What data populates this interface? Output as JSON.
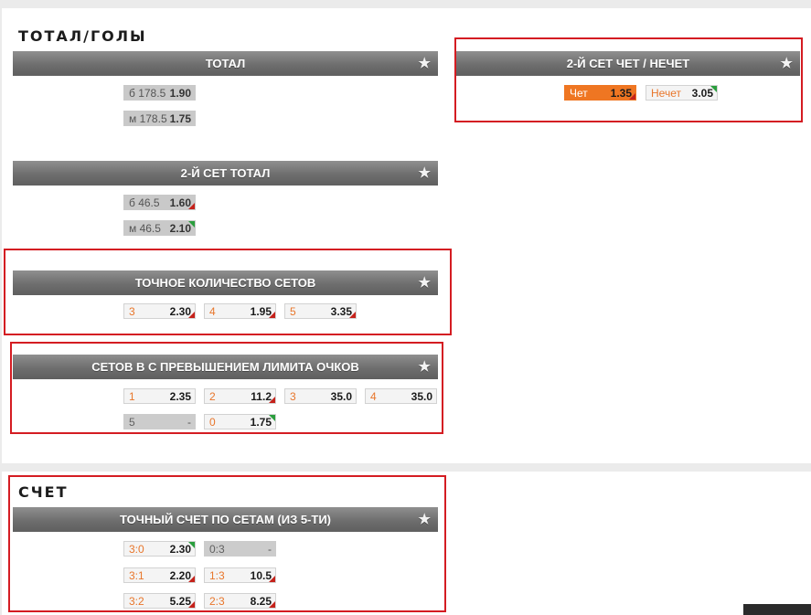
{
  "sections": {
    "total_title": "ТОТАЛ/ГОЛЫ",
    "score_title": "СЧЕТ"
  },
  "markets": {
    "total": {
      "title": "ТОТАЛ",
      "odds": [
        {
          "label": "б 178.5",
          "value": "1.90"
        },
        {
          "label": "м 178.5",
          "value": "1.75"
        }
      ]
    },
    "set2_total": {
      "title": "2-Й СЕТ ТОТАЛ",
      "odds": [
        {
          "label": "б 46.5",
          "value": "1.60"
        },
        {
          "label": "м 46.5",
          "value": "2.10"
        }
      ]
    },
    "exact_sets": {
      "title": "ТОЧНОЕ КОЛИЧЕСТВО СЕТОВ",
      "odds": [
        {
          "label": "3",
          "value": "2.30"
        },
        {
          "label": "4",
          "value": "1.95"
        },
        {
          "label": "5",
          "value": "3.35"
        }
      ]
    },
    "over_limit": {
      "title": "СЕТОВ В С ПРЕВЫШЕНИЕМ ЛИМИТА ОЧКОВ",
      "odds": [
        {
          "label": "1",
          "value": "2.35"
        },
        {
          "label": "2",
          "value": "11.2"
        },
        {
          "label": "3",
          "value": "35.0"
        },
        {
          "label": "4",
          "value": "35.0"
        },
        {
          "label": "5",
          "value": "-"
        },
        {
          "label": "0",
          "value": "1.75"
        }
      ]
    },
    "set2_oddeven": {
      "title": "2-Й СЕТ ЧЕТ / НЕЧЕТ",
      "odds": [
        {
          "label": "Чет",
          "value": "1.35"
        },
        {
          "label": "Нечет",
          "value": "3.05"
        }
      ]
    },
    "exact_score": {
      "title": "ТОЧНЫЙ СЧЕТ ПО СЕТАМ (ИЗ 5-ТИ)",
      "odds": [
        {
          "label": "3:0",
          "value": "2.30"
        },
        {
          "label": "0:3",
          "value": "-"
        },
        {
          "label": "3:1",
          "value": "2.20"
        },
        {
          "label": "1:3",
          "value": "10.5"
        },
        {
          "label": "3:2",
          "value": "5.25"
        },
        {
          "label": "2:3",
          "value": "8.25"
        }
      ]
    }
  },
  "icons": {
    "favorite": "★"
  },
  "colors": {
    "accent": "#ef7622",
    "highlight": "#d41c22",
    "trend_up": "#2a9e3d",
    "trend_down": "#c5221b"
  }
}
